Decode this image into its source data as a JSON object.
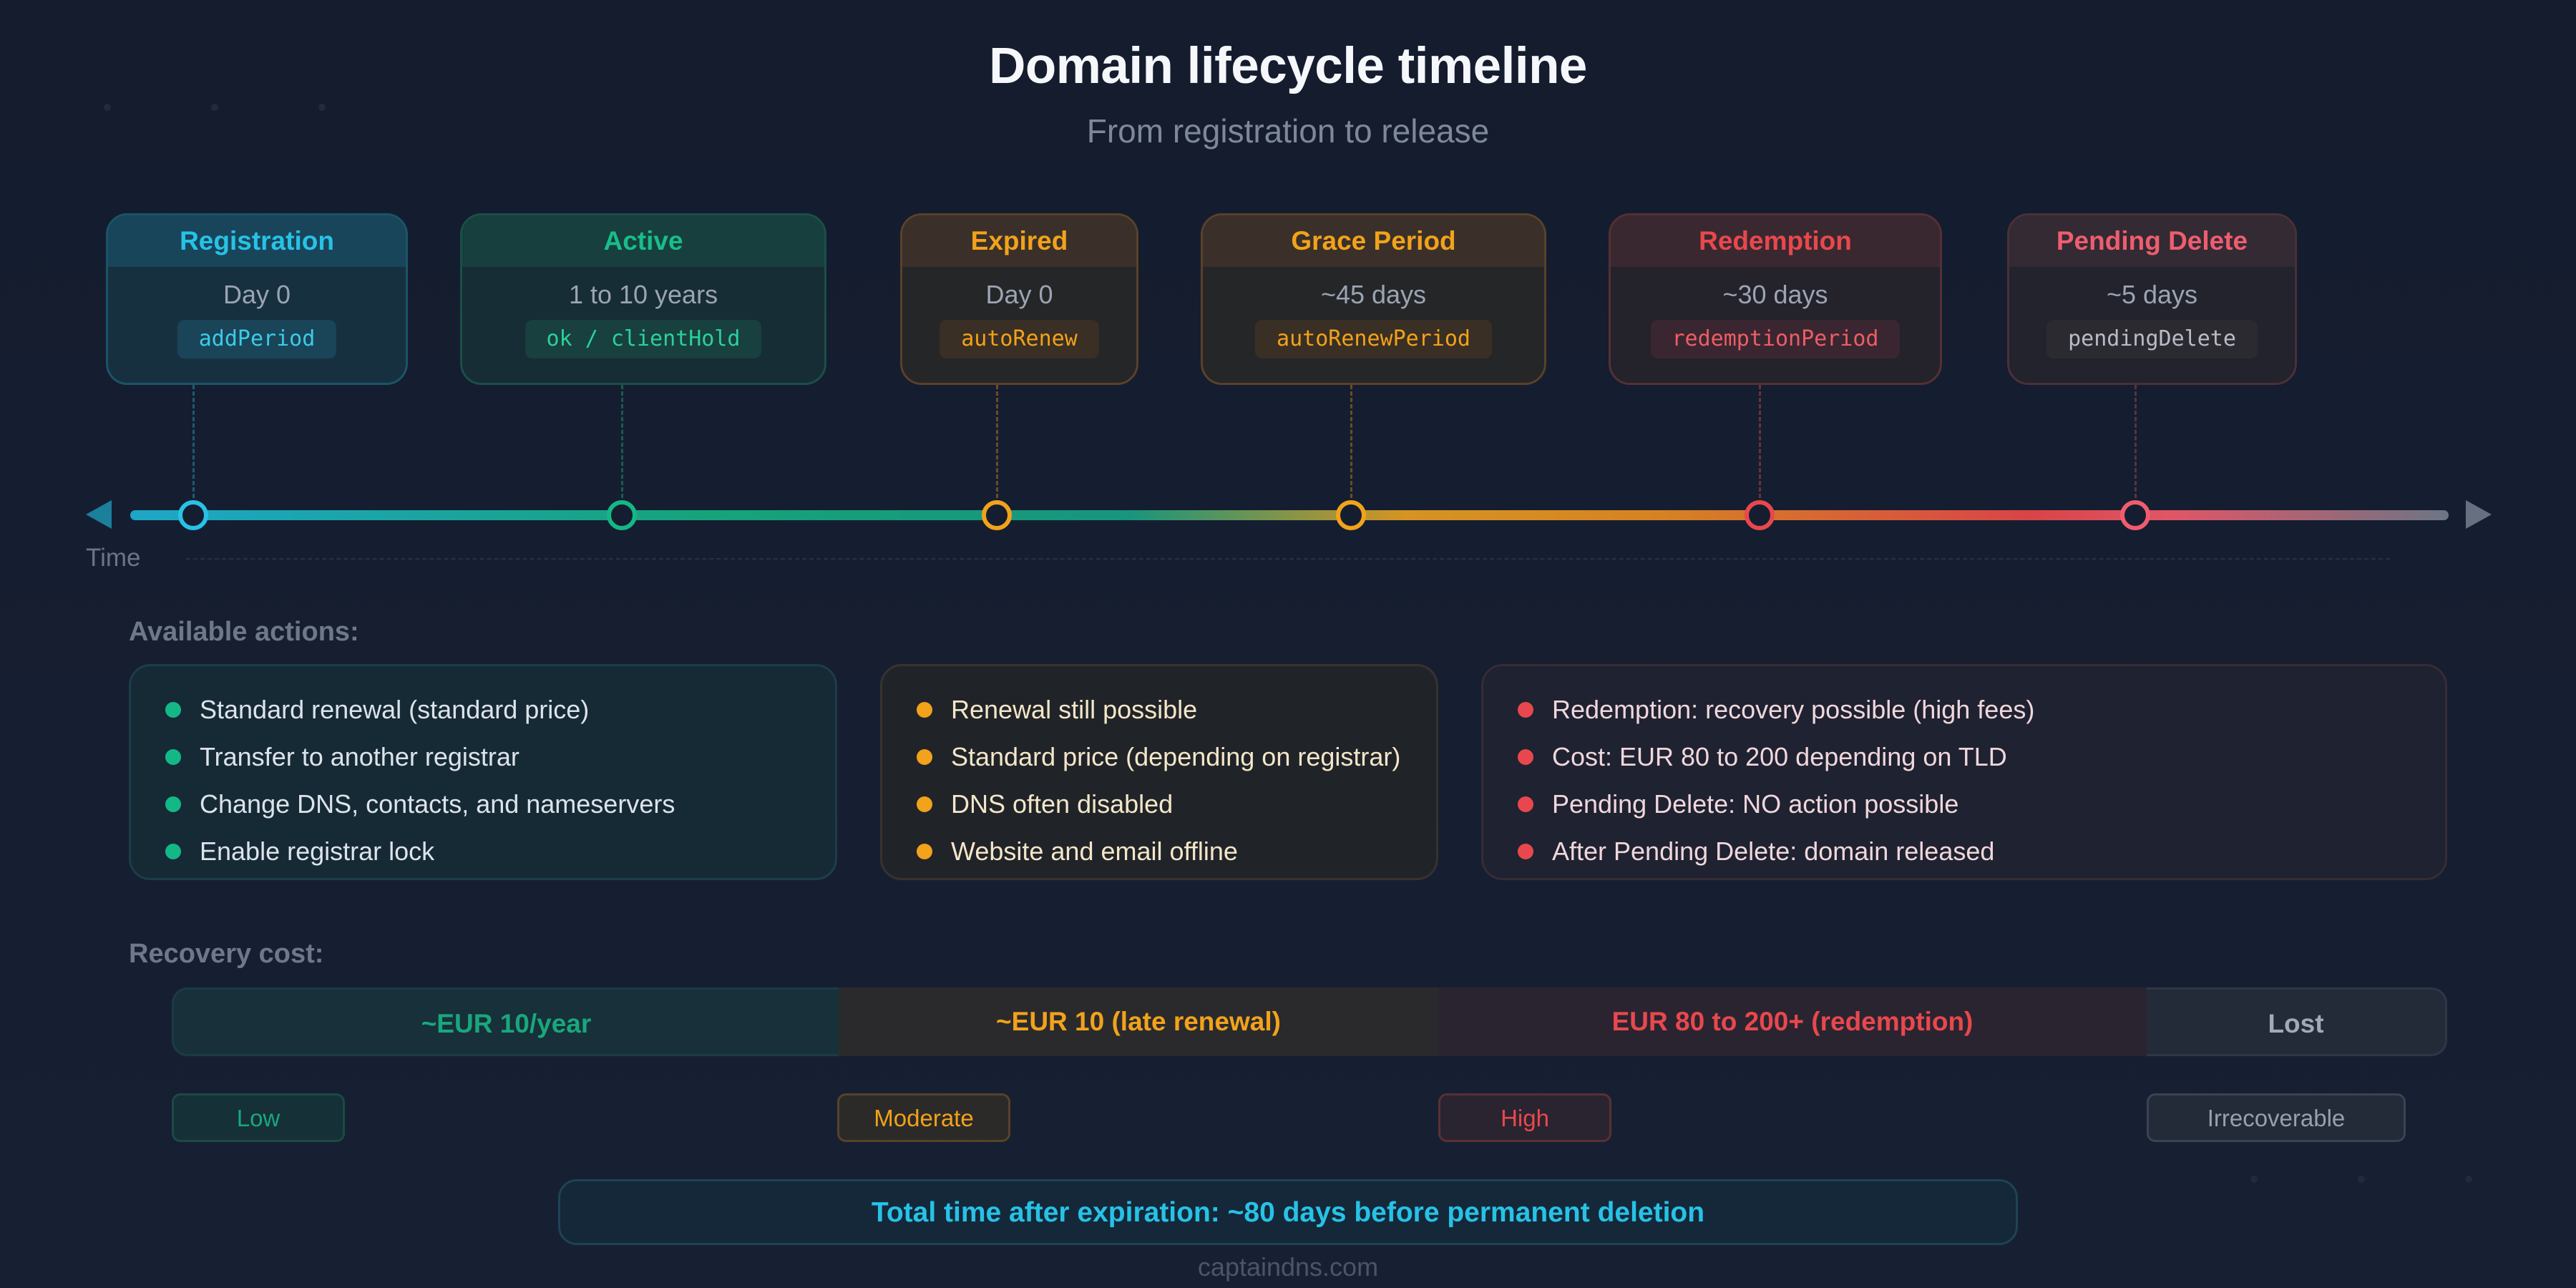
{
  "header": {
    "title": "Domain lifecycle timeline",
    "subtitle": "From registration to release"
  },
  "phases": [
    {
      "name": "Registration",
      "duration": "Day 0",
      "code": "addPeriod",
      "color": "#22b8e0"
    },
    {
      "name": "Active",
      "duration": "1 to 10 years",
      "code": "ok / clientHold",
      "color": "#14b886"
    },
    {
      "name": "Expired",
      "duration": "Day 0",
      "code": "autoRenew",
      "color": "#f2a21b"
    },
    {
      "name": "Grace Period",
      "duration": "~45 days",
      "code": "autoRenewPeriod",
      "color": "#f2a21b"
    },
    {
      "name": "Redemption",
      "duration": "~30 days",
      "code": "redemptionPeriod",
      "color": "#e8484d"
    },
    {
      "name": "Pending Delete",
      "duration": "~5 days",
      "code": "pendingDelete",
      "color": "#ee5d6f"
    }
  ],
  "timeline": {
    "axis_label": "Time"
  },
  "actions": {
    "label": "Available actions:",
    "groups": [
      {
        "color": "#14b886",
        "items": [
          "Standard renewal (standard price)",
          "Transfer to another registrar",
          "Change DNS, contacts, and nameservers",
          "Enable registrar lock"
        ]
      },
      {
        "color": "#f2a21b",
        "items": [
          "Renewal still possible",
          "Standard price (depending on registrar)",
          "DNS often disabled",
          "Website and email offline"
        ]
      },
      {
        "color": "#e8484d",
        "items": [
          "Redemption: recovery possible (high fees)",
          "Cost: EUR 80 to 200 depending on TLD",
          "Pending Delete: NO action possible",
          "After Pending Delete: domain released"
        ]
      }
    ]
  },
  "cost": {
    "label": "Recovery cost:",
    "segments": [
      {
        "text": "~EUR 10/year",
        "color": "#19a77c"
      },
      {
        "text": "~EUR 10 (late renewal)",
        "color": "#f2a21b"
      },
      {
        "text": "EUR 80 to 200+ (redemption)",
        "color": "#e8484d"
      },
      {
        "text": "Lost",
        "color": "#a2aab6"
      }
    ],
    "levels": [
      "Low",
      "Moderate",
      "High",
      "Irrecoverable"
    ]
  },
  "summary": "Total time after expiration: ~80 days before permanent deletion",
  "footer": "captaindns.com"
}
